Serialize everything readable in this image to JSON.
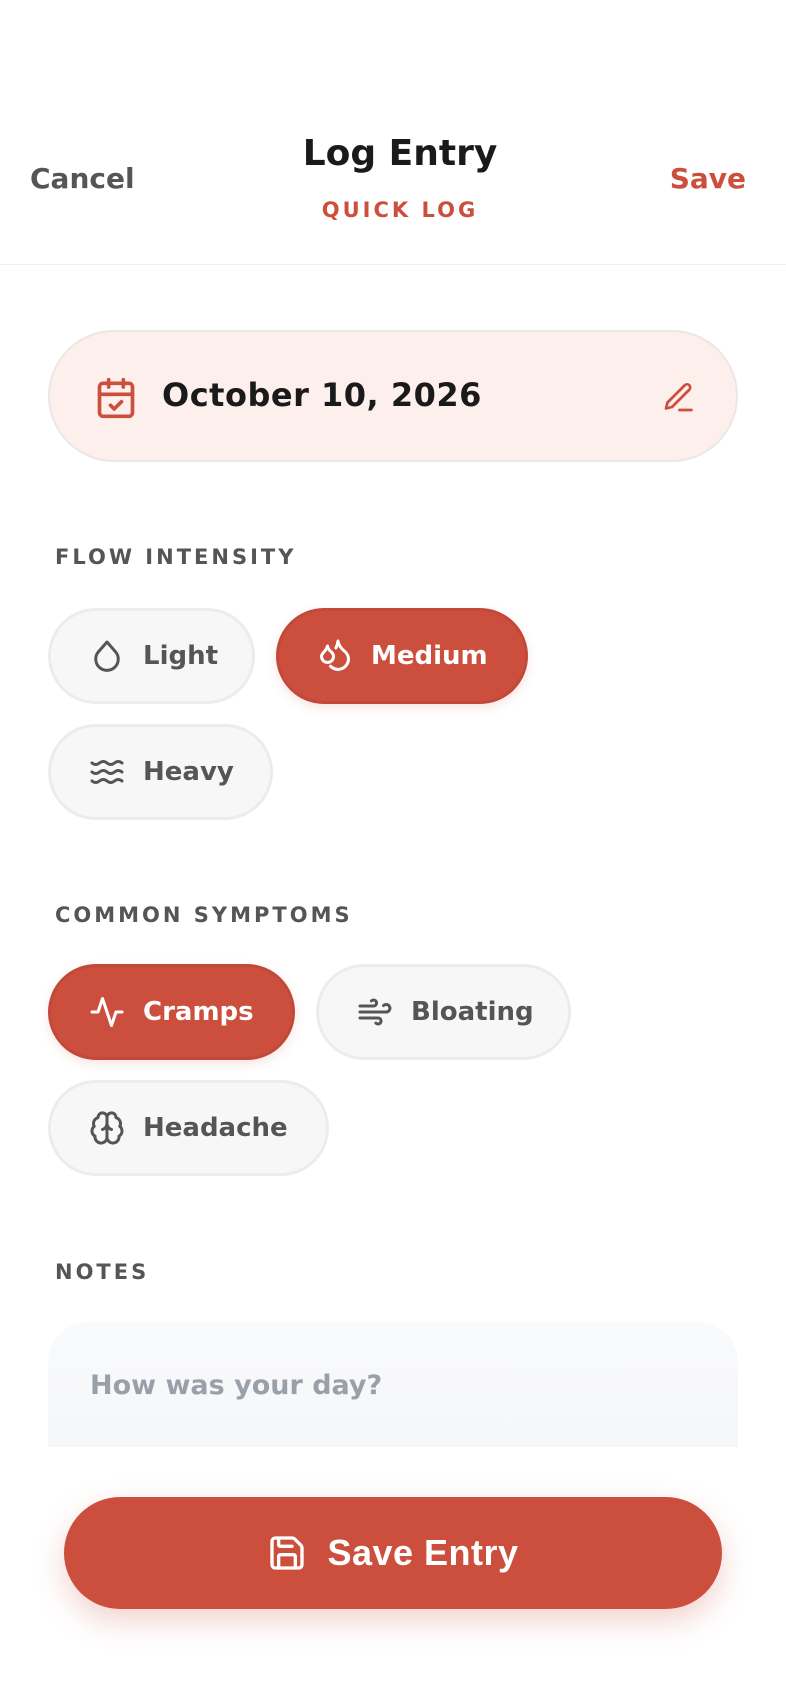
{
  "header": {
    "cancel_label": "Cancel",
    "title": "Log Entry",
    "subtitle": "QUICK LOG",
    "save_label": "Save"
  },
  "date": {
    "value": "October 10, 2026",
    "icon": "calendar-check-icon",
    "edit_icon": "pencil-icon"
  },
  "flow": {
    "label": "FLOW INTENSITY",
    "options": [
      {
        "label": "Light",
        "icon": "droplet-icon",
        "selected": false
      },
      {
        "label": "Medium",
        "icon": "droplets-icon",
        "selected": true
      },
      {
        "label": "Heavy",
        "icon": "waves-icon",
        "selected": false
      }
    ]
  },
  "symptoms": {
    "label": "COMMON SYMPTOMS",
    "options": [
      {
        "label": "Cramps",
        "icon": "activity-icon",
        "selected": true
      },
      {
        "label": "Bloating",
        "icon": "wind-icon",
        "selected": false
      },
      {
        "label": "Headache",
        "icon": "brain-icon",
        "selected": false
      }
    ]
  },
  "notes": {
    "label": "NOTES",
    "placeholder": "How was your day?",
    "value": ""
  },
  "footer": {
    "save_entry_label": "Save Entry",
    "icon": "floppy-disk-icon"
  },
  "colors": {
    "accent": "#cc4f3e",
    "date_card_bg": "#fdefec",
    "chip_bg": "#f7f7f7",
    "text_muted": "#555555",
    "placeholder": "#9aa0aa"
  }
}
